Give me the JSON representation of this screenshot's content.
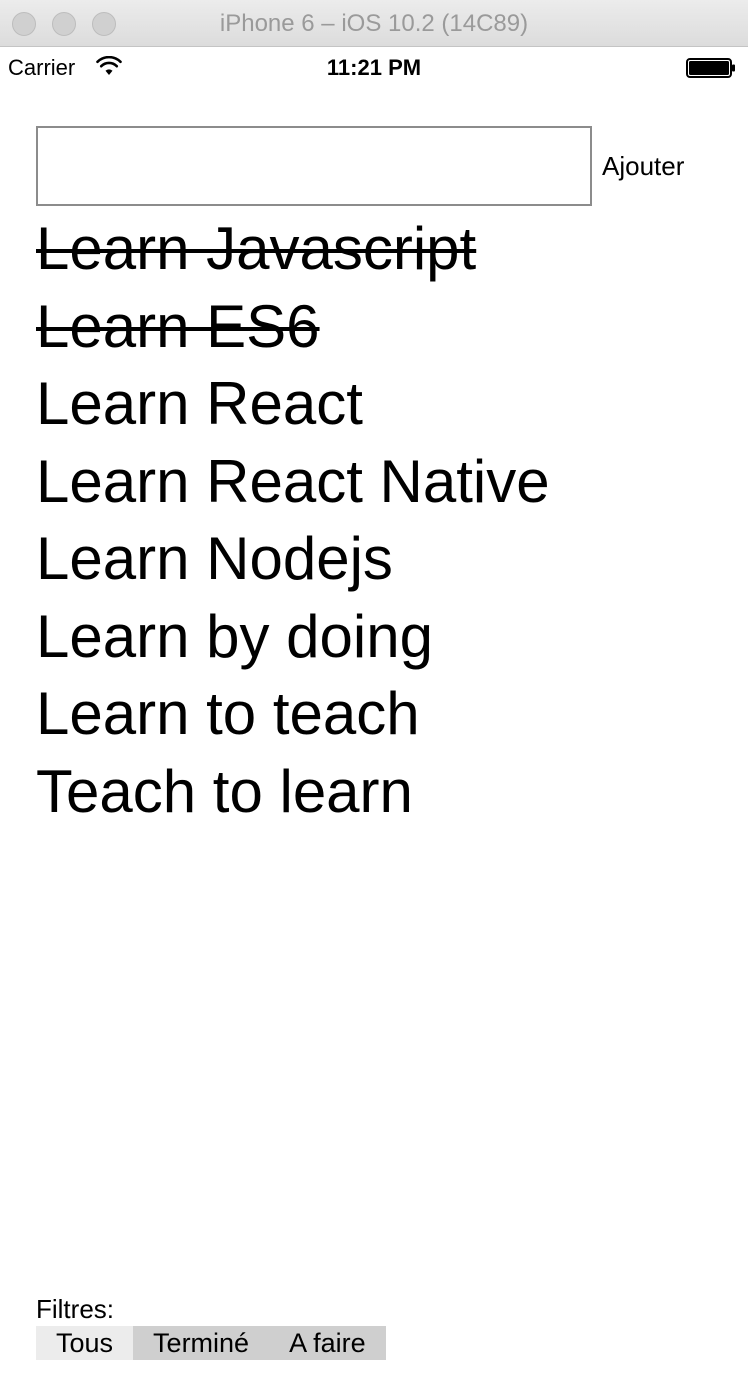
{
  "window": {
    "title": "iPhone 6 – iOS 10.2 (14C89)"
  },
  "status_bar": {
    "carrier": "Carrier",
    "time": "11:21 PM",
    "icons": [
      "wifi-icon",
      "battery-icon"
    ]
  },
  "new_todo": {
    "value": "",
    "placeholder": "",
    "add_label": "Ajouter"
  },
  "todos": [
    {
      "text": "Learn Javascript",
      "done": true
    },
    {
      "text": "Learn ES6",
      "done": true
    },
    {
      "text": "Learn React",
      "done": false
    },
    {
      "text": "Learn React Native",
      "done": false
    },
    {
      "text": "Learn Nodejs",
      "done": false
    },
    {
      "text": "Learn by doing",
      "done": false
    },
    {
      "text": "Learn to teach",
      "done": false
    },
    {
      "text": "Teach to learn",
      "done": false
    }
  ],
  "filters": {
    "label": "Filtres:",
    "options": [
      {
        "label": "Tous",
        "active": true
      },
      {
        "label": "Terminé",
        "active": false
      },
      {
        "label": "A faire",
        "active": false
      }
    ]
  },
  "colors": {
    "active_filter_bg": "#ececec",
    "filter_bar_bg": "#cfcfcf",
    "input_border": "#8c8c8c"
  }
}
